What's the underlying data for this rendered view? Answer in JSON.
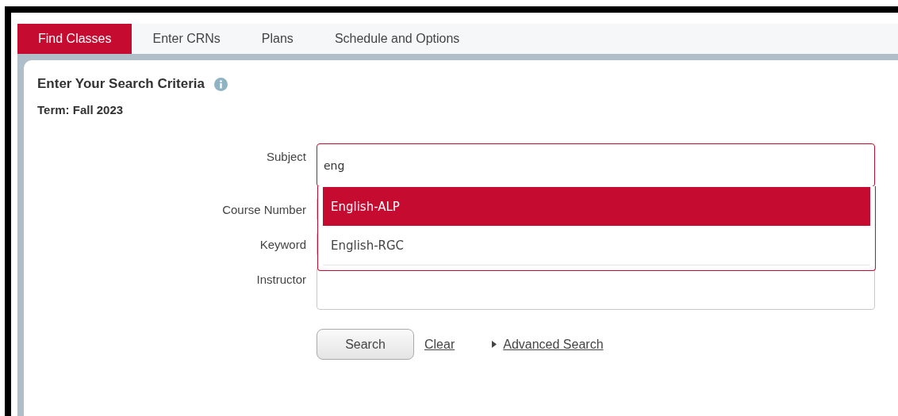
{
  "tabs": [
    {
      "label": "Find Classes",
      "selected": true
    },
    {
      "label": "Enter CRNs",
      "selected": false
    },
    {
      "label": "Plans",
      "selected": false
    },
    {
      "label": "Schedule and Options",
      "selected": false
    }
  ],
  "heading": "Enter Your Search Criteria",
  "term": "Term: Fall 2023",
  "fields": [
    {
      "label": "Subject",
      "value": "eng",
      "focused": true,
      "kind": "tall"
    },
    {
      "label": "Course Number",
      "focused": false,
      "kind": "short"
    },
    {
      "label": "Keyword",
      "focused": false,
      "kind": "short"
    },
    {
      "label": "Instructor",
      "focused": false,
      "kind": "tall"
    }
  ],
  "suggestions": [
    {
      "label": "English-ALP",
      "selected": true
    },
    {
      "label": "English-RGC",
      "selected": false
    }
  ],
  "actions": {
    "search": "Search",
    "clear": "Clear",
    "advanced": "Advanced Search"
  }
}
